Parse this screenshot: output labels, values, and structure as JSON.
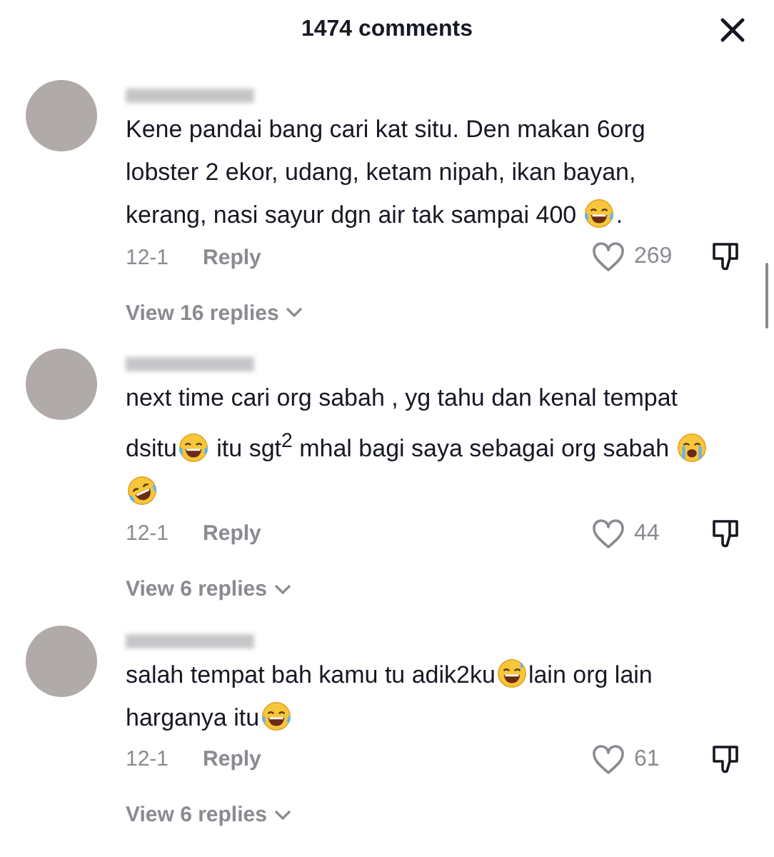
{
  "header": {
    "title": "1474 comments"
  },
  "comments": [
    {
      "segments": [
        {
          "kind": "text",
          "text": "Kene pandai bang cari kat situ. Den makan 6org lobster 2 ekor, udang, ketam nipah, ikan bayan, kerang, nasi sayur dgn air tak sampai 400 "
        },
        {
          "kind": "laughing"
        },
        {
          "kind": "text",
          "text": "."
        }
      ],
      "date": "12-1",
      "reply": "Reply",
      "likes": "269",
      "view_replies": "View 16 replies"
    },
    {
      "segments": [
        {
          "kind": "text",
          "text": "next time cari org sabah , yg tahu dan kenal tempat dsitu"
        },
        {
          "kind": "laughing"
        },
        {
          "kind": "text",
          "text": " itu sgt$^{2}$ mhal bagi saya sebagai org sabah "
        },
        {
          "kind": "crying"
        },
        {
          "kind": "rofl"
        }
      ],
      "date": "12-1",
      "reply": "Reply",
      "likes": "44",
      "view_replies": "View 6 replies"
    },
    {
      "segments": [
        {
          "kind": "text",
          "text": "salah tempat bah kamu tu adik2ku"
        },
        {
          "kind": "sweat-smile"
        },
        {
          "kind": "text",
          "text": "lain org lain harganya itu"
        },
        {
          "kind": "laughing"
        }
      ],
      "date": "12-1",
      "reply": "Reply",
      "likes": "61",
      "view_replies": "View 6 replies"
    }
  ]
}
